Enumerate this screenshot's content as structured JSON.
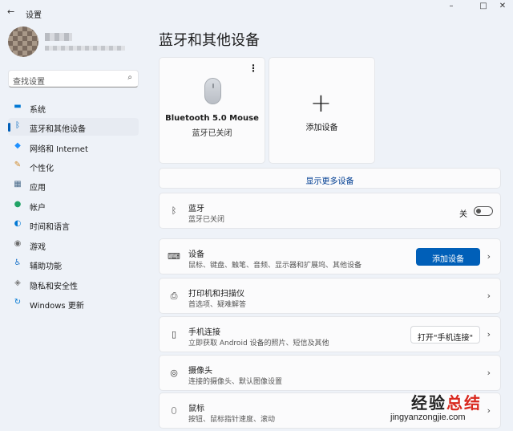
{
  "window": {
    "title": "设置",
    "back_icon": "back-arrow-icon",
    "minimize": "–",
    "maximize": "□",
    "close": "✕"
  },
  "search": {
    "placeholder": "查找设置",
    "icon": "⌕"
  },
  "sidebar": {
    "items": [
      {
        "label": "系统",
        "icon": "▬",
        "color": "#0078d4"
      },
      {
        "label": "蓝牙和其他设备",
        "icon": "ᛒ",
        "color": "#0067c0",
        "active": true
      },
      {
        "label": "网络和 Internet",
        "icon": "◆",
        "color": "#1e90ff"
      },
      {
        "label": "个性化",
        "icon": "✎",
        "color": "#d08a2a"
      },
      {
        "label": "应用",
        "icon": "▦",
        "color": "#4a6b8a"
      },
      {
        "label": "帐户",
        "icon": "●",
        "color": "#21a366"
      },
      {
        "label": "时间和语言",
        "icon": "◐",
        "color": "#0078d4"
      },
      {
        "label": "游戏",
        "icon": "◉",
        "color": "#6b6b6b"
      },
      {
        "label": "辅助功能",
        "icon": "♿",
        "color": "#1a73c9"
      },
      {
        "label": "隐私和安全性",
        "icon": "◈",
        "color": "#7a7a7a"
      },
      {
        "label": "Windows 更新",
        "icon": "↻",
        "color": "#0078d4"
      }
    ]
  },
  "main": {
    "title": "蓝牙和其他设备",
    "device_card": {
      "name": "Bluetooth 5.0 Mouse",
      "status": "蓝牙已关闭",
      "menu": "⋮"
    },
    "add_card": {
      "plus": "+",
      "label": "添加设备"
    },
    "show_more": "显示更多设备",
    "bluetooth": {
      "icon": "ᛒ",
      "title": "蓝牙",
      "subtitle": "蓝牙已关闭",
      "toggle_label": "关",
      "toggle_on": false
    },
    "rows": [
      {
        "icon": "⌨",
        "title": "设备",
        "subtitle": "鼠标、键盘、触笔、音频、显示器和扩展坞、其他设备",
        "button": "添加设备",
        "button_type": "primary"
      },
      {
        "icon": "⎙",
        "title": "打印机和扫描仪",
        "subtitle": "首选项、疑难解答"
      },
      {
        "icon": "▯",
        "title": "手机连接",
        "subtitle": "立即获取 Android 设备的照片、短信及其他",
        "button": "打开\"手机连接\"",
        "button_type": "secondary"
      },
      {
        "icon": "◎",
        "title": "摄像头",
        "subtitle": "连接的摄像头、默认图像设置"
      },
      {
        "icon": "⬯",
        "title": "鼠标",
        "subtitle": "按钮、鼠标指针速度、滚动"
      }
    ],
    "chevron": "›"
  },
  "watermark": {
    "text_black": "经验",
    "text_red": "总结",
    "url": "jingyanzongjie.com"
  }
}
